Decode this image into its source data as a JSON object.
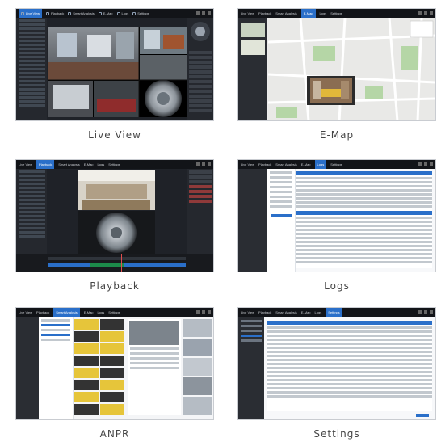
{
  "panels": [
    {
      "caption": "Live View",
      "tabs": [
        "Live View",
        "Playback",
        "Smart Analysis",
        "E-Map",
        "Logs",
        "Settings"
      ],
      "active_tab": "Live View"
    },
    {
      "caption": "E-Map",
      "tabs": [
        "Live View",
        "Playback",
        "Smart Analysis",
        "E-Map",
        "Logs",
        "Settings"
      ],
      "active_tab": "E-Map"
    },
    {
      "caption": "Playback",
      "tabs": [
        "Live View",
        "Playback",
        "Smart Analysis",
        "E-Map",
        "Logs",
        "Settings"
      ],
      "active_tab": "Playback"
    },
    {
      "caption": "Logs",
      "tabs": [
        "Live View",
        "Playback",
        "Smart Analysis",
        "E-Map",
        "Logs",
        "Settings"
      ],
      "active_tab": "Logs"
    },
    {
      "caption": "ANPR",
      "tabs": [
        "Live View",
        "Playback",
        "Smart Analysis",
        "E-Map",
        "Logs",
        "Settings"
      ],
      "active_tab": "Smart Analysis"
    },
    {
      "caption": "Settings",
      "tabs": [
        "Live View",
        "Playback",
        "Smart Analysis",
        "E-Map",
        "Logs",
        "Settings"
      ],
      "active_tab": "Settings"
    }
  ],
  "colors": {
    "accent": "#2a6fc9",
    "dark_bg": "#1f2228",
    "topbar": "#121418",
    "caption_text": "#444444"
  }
}
